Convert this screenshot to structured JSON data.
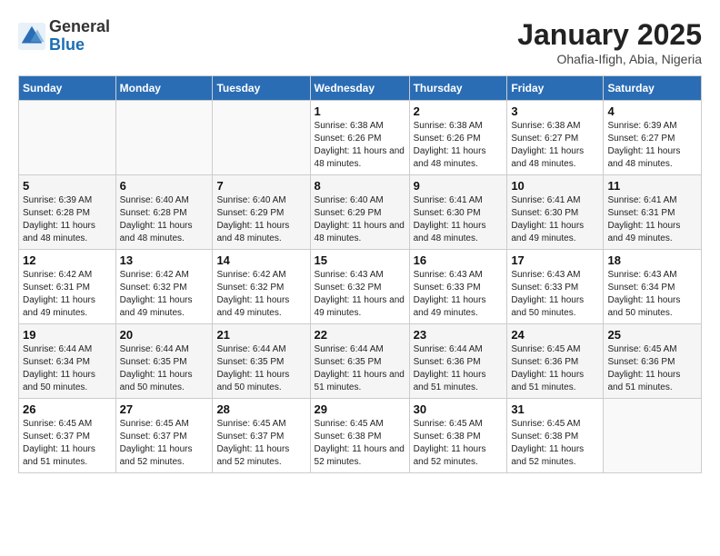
{
  "header": {
    "logo_general": "General",
    "logo_blue": "Blue",
    "month_title": "January 2025",
    "subtitle": "Ohafia-Ifigh, Abia, Nigeria"
  },
  "weekdays": [
    "Sunday",
    "Monday",
    "Tuesday",
    "Wednesday",
    "Thursday",
    "Friday",
    "Saturday"
  ],
  "weeks": [
    [
      {
        "day": "",
        "info": ""
      },
      {
        "day": "",
        "info": ""
      },
      {
        "day": "",
        "info": ""
      },
      {
        "day": "1",
        "info": "Sunrise: 6:38 AM\nSunset: 6:26 PM\nDaylight: 11 hours\nand 48 minutes."
      },
      {
        "day": "2",
        "info": "Sunrise: 6:38 AM\nSunset: 6:26 PM\nDaylight: 11 hours\nand 48 minutes."
      },
      {
        "day": "3",
        "info": "Sunrise: 6:38 AM\nSunset: 6:27 PM\nDaylight: 11 hours\nand 48 minutes."
      },
      {
        "day": "4",
        "info": "Sunrise: 6:39 AM\nSunset: 6:27 PM\nDaylight: 11 hours\nand 48 minutes."
      }
    ],
    [
      {
        "day": "5",
        "info": "Sunrise: 6:39 AM\nSunset: 6:28 PM\nDaylight: 11 hours\nand 48 minutes."
      },
      {
        "day": "6",
        "info": "Sunrise: 6:40 AM\nSunset: 6:28 PM\nDaylight: 11 hours\nand 48 minutes."
      },
      {
        "day": "7",
        "info": "Sunrise: 6:40 AM\nSunset: 6:29 PM\nDaylight: 11 hours\nand 48 minutes."
      },
      {
        "day": "8",
        "info": "Sunrise: 6:40 AM\nSunset: 6:29 PM\nDaylight: 11 hours\nand 48 minutes."
      },
      {
        "day": "9",
        "info": "Sunrise: 6:41 AM\nSunset: 6:30 PM\nDaylight: 11 hours\nand 48 minutes."
      },
      {
        "day": "10",
        "info": "Sunrise: 6:41 AM\nSunset: 6:30 PM\nDaylight: 11 hours\nand 49 minutes."
      },
      {
        "day": "11",
        "info": "Sunrise: 6:41 AM\nSunset: 6:31 PM\nDaylight: 11 hours\nand 49 minutes."
      }
    ],
    [
      {
        "day": "12",
        "info": "Sunrise: 6:42 AM\nSunset: 6:31 PM\nDaylight: 11 hours\nand 49 minutes."
      },
      {
        "day": "13",
        "info": "Sunrise: 6:42 AM\nSunset: 6:32 PM\nDaylight: 11 hours\nand 49 minutes."
      },
      {
        "day": "14",
        "info": "Sunrise: 6:42 AM\nSunset: 6:32 PM\nDaylight: 11 hours\nand 49 minutes."
      },
      {
        "day": "15",
        "info": "Sunrise: 6:43 AM\nSunset: 6:32 PM\nDaylight: 11 hours\nand 49 minutes."
      },
      {
        "day": "16",
        "info": "Sunrise: 6:43 AM\nSunset: 6:33 PM\nDaylight: 11 hours\nand 49 minutes."
      },
      {
        "day": "17",
        "info": "Sunrise: 6:43 AM\nSunset: 6:33 PM\nDaylight: 11 hours\nand 50 minutes."
      },
      {
        "day": "18",
        "info": "Sunrise: 6:43 AM\nSunset: 6:34 PM\nDaylight: 11 hours\nand 50 minutes."
      }
    ],
    [
      {
        "day": "19",
        "info": "Sunrise: 6:44 AM\nSunset: 6:34 PM\nDaylight: 11 hours\nand 50 minutes."
      },
      {
        "day": "20",
        "info": "Sunrise: 6:44 AM\nSunset: 6:35 PM\nDaylight: 11 hours\nand 50 minutes."
      },
      {
        "day": "21",
        "info": "Sunrise: 6:44 AM\nSunset: 6:35 PM\nDaylight: 11 hours\nand 50 minutes."
      },
      {
        "day": "22",
        "info": "Sunrise: 6:44 AM\nSunset: 6:35 PM\nDaylight: 11 hours\nand 51 minutes."
      },
      {
        "day": "23",
        "info": "Sunrise: 6:44 AM\nSunset: 6:36 PM\nDaylight: 11 hours\nand 51 minutes."
      },
      {
        "day": "24",
        "info": "Sunrise: 6:45 AM\nSunset: 6:36 PM\nDaylight: 11 hours\nand 51 minutes."
      },
      {
        "day": "25",
        "info": "Sunrise: 6:45 AM\nSunset: 6:36 PM\nDaylight: 11 hours\nand 51 minutes."
      }
    ],
    [
      {
        "day": "26",
        "info": "Sunrise: 6:45 AM\nSunset: 6:37 PM\nDaylight: 11 hours\nand 51 minutes."
      },
      {
        "day": "27",
        "info": "Sunrise: 6:45 AM\nSunset: 6:37 PM\nDaylight: 11 hours\nand 52 minutes."
      },
      {
        "day": "28",
        "info": "Sunrise: 6:45 AM\nSunset: 6:37 PM\nDaylight: 11 hours\nand 52 minutes."
      },
      {
        "day": "29",
        "info": "Sunrise: 6:45 AM\nSunset: 6:38 PM\nDaylight: 11 hours\nand 52 minutes."
      },
      {
        "day": "30",
        "info": "Sunrise: 6:45 AM\nSunset: 6:38 PM\nDaylight: 11 hours\nand 52 minutes."
      },
      {
        "day": "31",
        "info": "Sunrise: 6:45 AM\nSunset: 6:38 PM\nDaylight: 11 hours\nand 52 minutes."
      },
      {
        "day": "",
        "info": ""
      }
    ]
  ]
}
